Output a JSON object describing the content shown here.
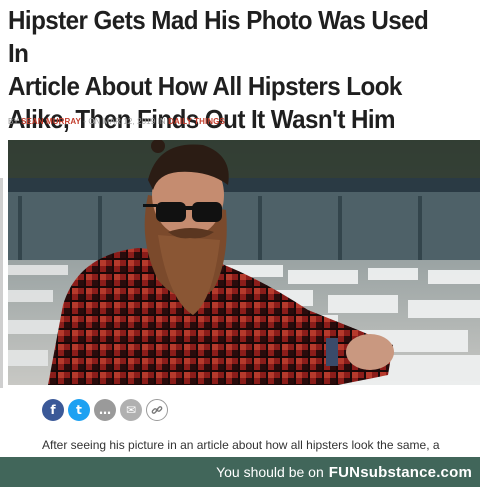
{
  "article": {
    "headline_lines": [
      "Hipster Gets Mad His Photo Was Used In",
      "Article About How All Hipsters Look",
      "Alike, Then Finds Out It Wasn't Him"
    ],
    "byline": {
      "prefix": "BY",
      "author": "SEAN MURRAY",
      "date_text": "- ON MAR 12, 2019 IN",
      "category": "DAILY THINGS"
    },
    "photo_description_icon": "bearded-man-photo",
    "share_buttons": [
      {
        "name": "facebook-share-button",
        "glyph": "f"
      },
      {
        "name": "twitter-share-button",
        "glyph": "t"
      },
      {
        "name": "comment-share-button",
        "glyph": "…"
      },
      {
        "name": "email-share-button",
        "glyph": "✉"
      },
      {
        "name": "link-share-button",
        "glyph": "🔗"
      }
    ],
    "body_snippet": "After seeing his picture in an article about how all hipsters look the same, a"
  },
  "footer": {
    "text": "You should be on",
    "brand": "FUNsubstance.com"
  }
}
